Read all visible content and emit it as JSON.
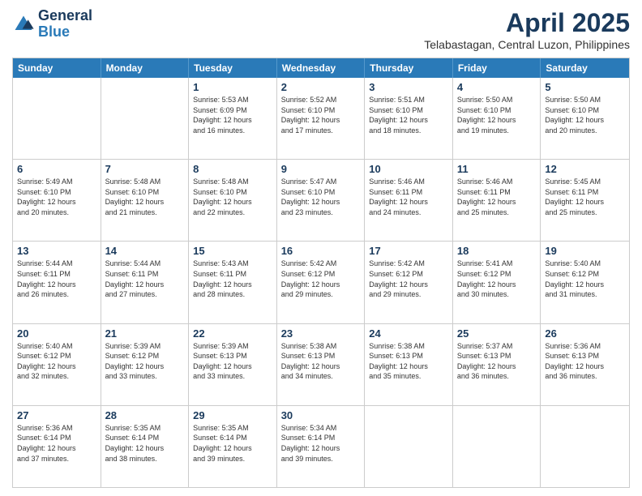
{
  "header": {
    "logo_general": "General",
    "logo_blue": "Blue",
    "month_title": "April 2025",
    "location": "Telabastagan, Central Luzon, Philippines"
  },
  "days_of_week": [
    "Sunday",
    "Monday",
    "Tuesday",
    "Wednesday",
    "Thursday",
    "Friday",
    "Saturday"
  ],
  "weeks": [
    [
      {
        "day": "",
        "info": ""
      },
      {
        "day": "",
        "info": ""
      },
      {
        "day": "1",
        "info": "Sunrise: 5:53 AM\nSunset: 6:09 PM\nDaylight: 12 hours\nand 16 minutes."
      },
      {
        "day": "2",
        "info": "Sunrise: 5:52 AM\nSunset: 6:10 PM\nDaylight: 12 hours\nand 17 minutes."
      },
      {
        "day": "3",
        "info": "Sunrise: 5:51 AM\nSunset: 6:10 PM\nDaylight: 12 hours\nand 18 minutes."
      },
      {
        "day": "4",
        "info": "Sunrise: 5:50 AM\nSunset: 6:10 PM\nDaylight: 12 hours\nand 19 minutes."
      },
      {
        "day": "5",
        "info": "Sunrise: 5:50 AM\nSunset: 6:10 PM\nDaylight: 12 hours\nand 20 minutes."
      }
    ],
    [
      {
        "day": "6",
        "info": "Sunrise: 5:49 AM\nSunset: 6:10 PM\nDaylight: 12 hours\nand 20 minutes."
      },
      {
        "day": "7",
        "info": "Sunrise: 5:48 AM\nSunset: 6:10 PM\nDaylight: 12 hours\nand 21 minutes."
      },
      {
        "day": "8",
        "info": "Sunrise: 5:48 AM\nSunset: 6:10 PM\nDaylight: 12 hours\nand 22 minutes."
      },
      {
        "day": "9",
        "info": "Sunrise: 5:47 AM\nSunset: 6:10 PM\nDaylight: 12 hours\nand 23 minutes."
      },
      {
        "day": "10",
        "info": "Sunrise: 5:46 AM\nSunset: 6:11 PM\nDaylight: 12 hours\nand 24 minutes."
      },
      {
        "day": "11",
        "info": "Sunrise: 5:46 AM\nSunset: 6:11 PM\nDaylight: 12 hours\nand 25 minutes."
      },
      {
        "day": "12",
        "info": "Sunrise: 5:45 AM\nSunset: 6:11 PM\nDaylight: 12 hours\nand 25 minutes."
      }
    ],
    [
      {
        "day": "13",
        "info": "Sunrise: 5:44 AM\nSunset: 6:11 PM\nDaylight: 12 hours\nand 26 minutes."
      },
      {
        "day": "14",
        "info": "Sunrise: 5:44 AM\nSunset: 6:11 PM\nDaylight: 12 hours\nand 27 minutes."
      },
      {
        "day": "15",
        "info": "Sunrise: 5:43 AM\nSunset: 6:11 PM\nDaylight: 12 hours\nand 28 minutes."
      },
      {
        "day": "16",
        "info": "Sunrise: 5:42 AM\nSunset: 6:12 PM\nDaylight: 12 hours\nand 29 minutes."
      },
      {
        "day": "17",
        "info": "Sunrise: 5:42 AM\nSunset: 6:12 PM\nDaylight: 12 hours\nand 29 minutes."
      },
      {
        "day": "18",
        "info": "Sunrise: 5:41 AM\nSunset: 6:12 PM\nDaylight: 12 hours\nand 30 minutes."
      },
      {
        "day": "19",
        "info": "Sunrise: 5:40 AM\nSunset: 6:12 PM\nDaylight: 12 hours\nand 31 minutes."
      }
    ],
    [
      {
        "day": "20",
        "info": "Sunrise: 5:40 AM\nSunset: 6:12 PM\nDaylight: 12 hours\nand 32 minutes."
      },
      {
        "day": "21",
        "info": "Sunrise: 5:39 AM\nSunset: 6:12 PM\nDaylight: 12 hours\nand 33 minutes."
      },
      {
        "day": "22",
        "info": "Sunrise: 5:39 AM\nSunset: 6:13 PM\nDaylight: 12 hours\nand 33 minutes."
      },
      {
        "day": "23",
        "info": "Sunrise: 5:38 AM\nSunset: 6:13 PM\nDaylight: 12 hours\nand 34 minutes."
      },
      {
        "day": "24",
        "info": "Sunrise: 5:38 AM\nSunset: 6:13 PM\nDaylight: 12 hours\nand 35 minutes."
      },
      {
        "day": "25",
        "info": "Sunrise: 5:37 AM\nSunset: 6:13 PM\nDaylight: 12 hours\nand 36 minutes."
      },
      {
        "day": "26",
        "info": "Sunrise: 5:36 AM\nSunset: 6:13 PM\nDaylight: 12 hours\nand 36 minutes."
      }
    ],
    [
      {
        "day": "27",
        "info": "Sunrise: 5:36 AM\nSunset: 6:14 PM\nDaylight: 12 hours\nand 37 minutes."
      },
      {
        "day": "28",
        "info": "Sunrise: 5:35 AM\nSunset: 6:14 PM\nDaylight: 12 hours\nand 38 minutes."
      },
      {
        "day": "29",
        "info": "Sunrise: 5:35 AM\nSunset: 6:14 PM\nDaylight: 12 hours\nand 39 minutes."
      },
      {
        "day": "30",
        "info": "Sunrise: 5:34 AM\nSunset: 6:14 PM\nDaylight: 12 hours\nand 39 minutes."
      },
      {
        "day": "",
        "info": ""
      },
      {
        "day": "",
        "info": ""
      },
      {
        "day": "",
        "info": ""
      }
    ]
  ]
}
